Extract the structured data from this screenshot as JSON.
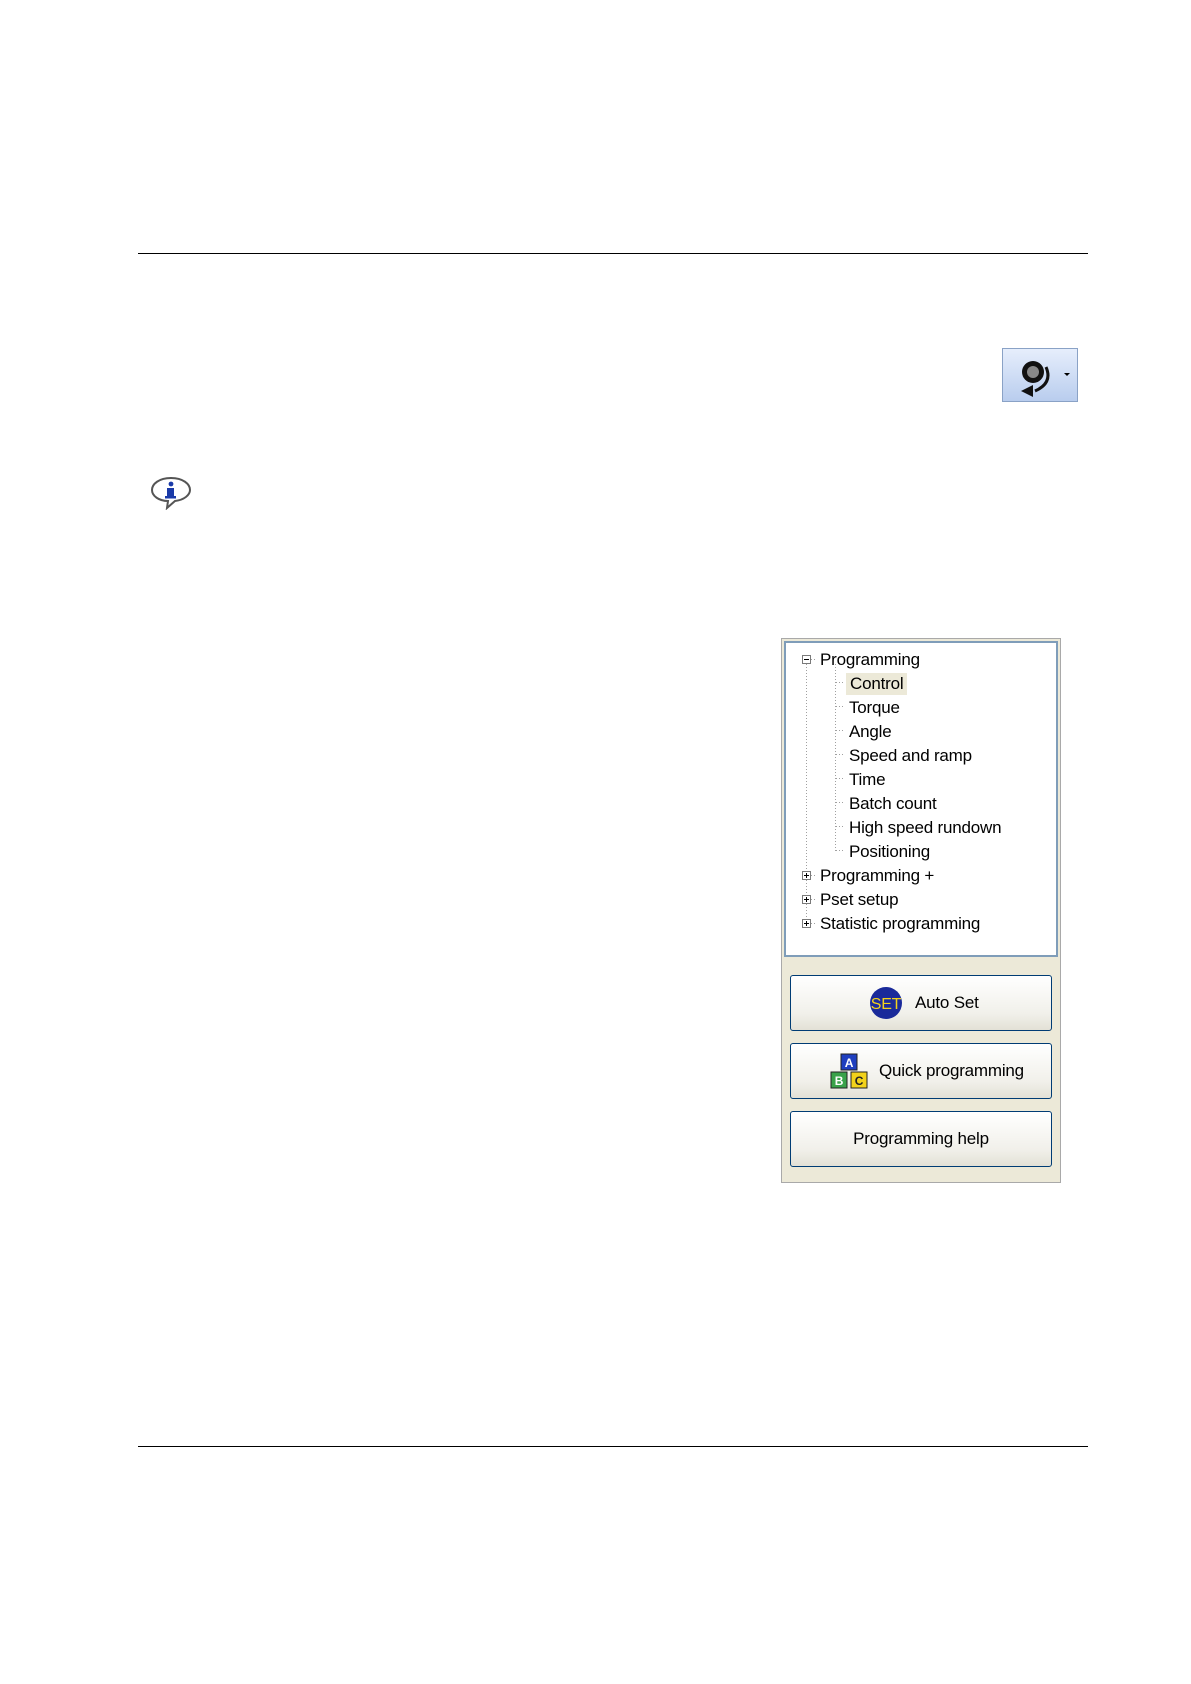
{
  "toolbar": {
    "dropdown_icon": "tightening-program-icon"
  },
  "note": {
    "icon": "info-speech-bubble-icon"
  },
  "panel": {
    "tree": [
      {
        "label": "Programming",
        "expanded": true,
        "children": [
          "Control",
          "Torque",
          "Angle",
          "Speed and ramp",
          "Time",
          "Batch count",
          "High speed rundown",
          "Positioning"
        ],
        "selected": "Control"
      },
      {
        "label": "Programming +",
        "expanded": false
      },
      {
        "label": "Pset setup",
        "expanded": false
      },
      {
        "label": "Statistic programming",
        "expanded": false
      }
    ],
    "buttons": {
      "auto_set": "Auto Set",
      "auto_set_icon_text": "SET",
      "quick_programming": "Quick programming",
      "programming_help": "Programming help"
    },
    "blocks_icon_letters": [
      "A",
      "B",
      "C"
    ]
  }
}
